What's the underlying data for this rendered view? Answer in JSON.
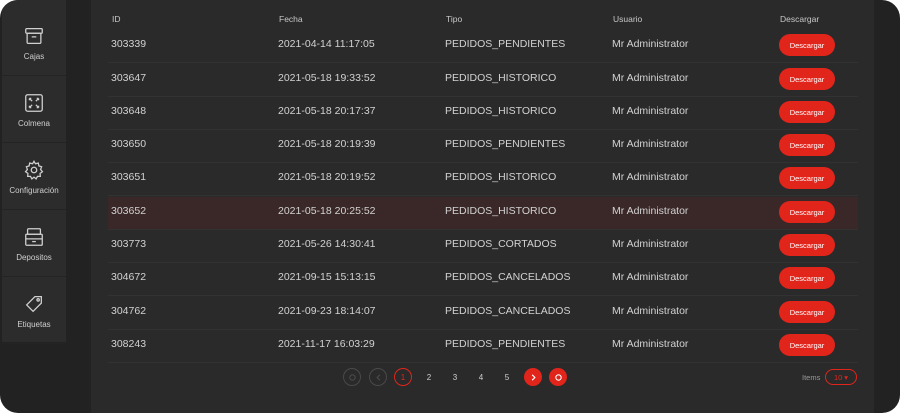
{
  "sidebar": {
    "items": [
      {
        "label": "Cajas",
        "icon": "box-icon"
      },
      {
        "label": "Colmena",
        "icon": "expand-grid-icon"
      },
      {
        "label": "Configuración",
        "icon": "gear-icon"
      },
      {
        "label": "Depositos",
        "icon": "warehouse-icon"
      },
      {
        "label": "Etiquetas",
        "icon": "tag-icon"
      }
    ]
  },
  "table": {
    "headers": {
      "id": "ID",
      "fecha": "Fecha",
      "tipo": "Tipo",
      "usuario": "Usuario",
      "descargar": "Descargar"
    },
    "button_label": "Descargar",
    "rows": [
      {
        "id": "303339",
        "fecha": "2021-04-14 11:17:05",
        "tipo": "PEDIDOS_PENDIENTES",
        "usuario": "Mr Administrator"
      },
      {
        "id": "303647",
        "fecha": "2021-05-18 19:33:52",
        "tipo": "PEDIDOS_HISTORICO",
        "usuario": "Mr Administrator"
      },
      {
        "id": "303648",
        "fecha": "2021-05-18 20:17:37",
        "tipo": "PEDIDOS_HISTORICO",
        "usuario": "Mr Administrator"
      },
      {
        "id": "303650",
        "fecha": "2021-05-18 20:19:39",
        "tipo": "PEDIDOS_PENDIENTES",
        "usuario": "Mr Administrator"
      },
      {
        "id": "303651",
        "fecha": "2021-05-18 20:19:52",
        "tipo": "PEDIDOS_HISTORICO",
        "usuario": "Mr Administrator"
      },
      {
        "id": "303652",
        "fecha": "2021-05-18 20:25:52",
        "tipo": "PEDIDOS_HISTORICO",
        "usuario": "Mr Administrator"
      },
      {
        "id": "303773",
        "fecha": "2021-05-26 14:30:41",
        "tipo": "PEDIDOS_CORTADOS",
        "usuario": "Mr Administrator"
      },
      {
        "id": "304672",
        "fecha": "2021-09-15 15:13:15",
        "tipo": "PEDIDOS_CANCELADOS",
        "usuario": "Mr Administrator"
      },
      {
        "id": "304762",
        "fecha": "2021-09-23 18:14:07",
        "tipo": "PEDIDOS_CANCELADOS",
        "usuario": "Mr Administrator"
      },
      {
        "id": "308243",
        "fecha": "2021-11-17 16:03:29",
        "tipo": "PEDIDOS_PENDIENTES",
        "usuario": "Mr Administrator"
      }
    ]
  },
  "pagination": {
    "pages": [
      "1",
      "2",
      "3",
      "4",
      "5"
    ],
    "current": "1",
    "items_label": "Items",
    "items_per_page": "10"
  },
  "colors": {
    "accent": "#e1251b",
    "background": "#222222",
    "panel": "#2a2a2a",
    "highlight_row": "#3a2828"
  }
}
